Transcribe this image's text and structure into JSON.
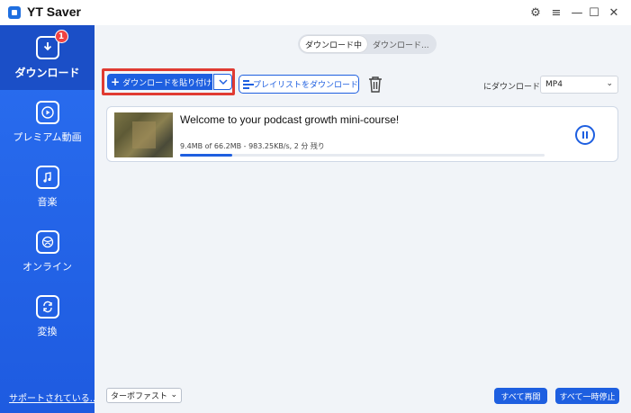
{
  "app": {
    "title": "YT Saver"
  },
  "window_controls": {
    "settings_icon": "gear-icon",
    "menu_icon": "menu-icon",
    "minimize_icon": "minimize-icon",
    "maximize_icon": "maximize-icon",
    "close_icon": "close-icon"
  },
  "sidebar": {
    "items": [
      {
        "label": "ダウンロード",
        "icon": "download-icon",
        "badge": "1",
        "active": true
      },
      {
        "label": "プレミアム動画",
        "icon": "play-icon"
      },
      {
        "label": "音楽",
        "icon": "music-icon"
      },
      {
        "label": "オンライン",
        "icon": "globe-icon"
      },
      {
        "label": "変換",
        "icon": "convert-icon"
      }
    ],
    "support_link": "サポートされている..."
  },
  "tabs": [
    {
      "label": "ダウンロード中",
      "active": true
    },
    {
      "label": "ダウンロード..."
    }
  ],
  "toolbar": {
    "paste_label": "ダウンロードを貼り付け",
    "playlist_label": "プレイリストをダウンロード",
    "format_label": "にダウンロード",
    "format_value": "MP4"
  },
  "downloads": [
    {
      "title": "Welcome to your podcast growth mini-course!",
      "meta": "9.4MB of 66.2MB -  983.25KB/s, 2 分 残り",
      "progress": 0.142
    }
  ],
  "footer": {
    "speed_value": "ターボファスト",
    "resume_all": "すべて再開",
    "pause_all": "すべて一時停止"
  },
  "colors": {
    "accent": "#1e5fe0",
    "sidebar": "#2a6ef0",
    "highlight": "#e03b32"
  }
}
